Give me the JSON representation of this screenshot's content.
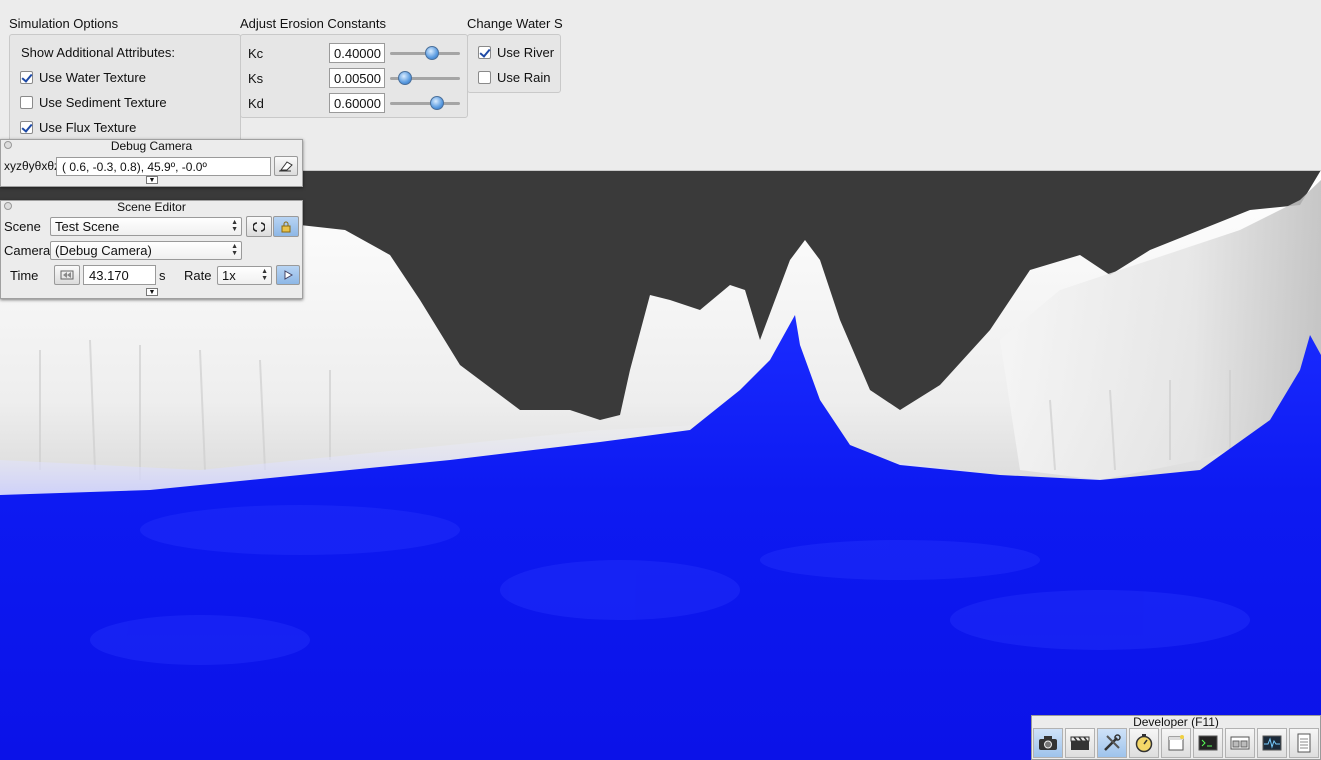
{
  "simulation_options": {
    "title": "Simulation Options",
    "show_attributes_label": "Show Additional Attributes:",
    "checkboxes": [
      {
        "label": "Use Water Texture",
        "checked": true
      },
      {
        "label": "Use Sediment Texture",
        "checked": false
      },
      {
        "label": "Use Flux Texture",
        "checked": true
      }
    ]
  },
  "erosion": {
    "title": "Adjust Erosion Constants",
    "constants": [
      {
        "label": "Kc",
        "value": "0.40000",
        "level": 0.62
      },
      {
        "label": "Ks",
        "value": "0.00500",
        "level": 0.15
      },
      {
        "label": "Kd",
        "value": "0.60000",
        "level": 0.72
      }
    ]
  },
  "water_source": {
    "title": "Change Water S",
    "checkboxes": [
      {
        "label": "Use River",
        "checked": true
      },
      {
        "label": "Use Rain",
        "checked": false
      }
    ]
  },
  "debug_camera": {
    "title": "Debug Camera",
    "axis_label": "xyzθyθxθz",
    "value": "(  0.6,  -0.3,   0.8),  45.9º,  -0.0º"
  },
  "scene_editor": {
    "title": "Scene Editor",
    "scene_label": "Scene",
    "scene_value": "Test Scene",
    "camera_label": "Camera",
    "camera_value": "(Debug Camera)",
    "time_label": "Time",
    "time_value": "43.170",
    "time_unit": "s",
    "rate_label": "Rate",
    "rate_value": "1x"
  },
  "developer": {
    "title": "Developer (F11)",
    "tools": [
      "camera-icon",
      "clapperboard-icon",
      "wrench-screwdriver-icon",
      "stopwatch-icon",
      "note-icon",
      "terminal-icon",
      "windows-icon",
      "waveform-icon",
      "document-icon"
    ]
  },
  "colors": {
    "water": "#0b13f2",
    "terrain": "#f2f2f2",
    "sky": "#3a3a3a",
    "panel": "#ececec"
  }
}
